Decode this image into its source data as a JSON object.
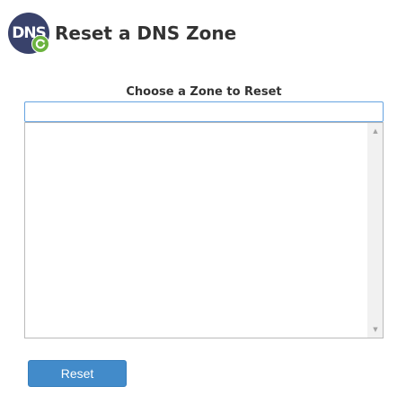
{
  "header": {
    "logo_text": "DNS",
    "logo_icon": "dns-logo-icon",
    "title": "Reset a DNS Zone"
  },
  "form": {
    "zone_label": "Choose a Zone to Reset",
    "search_value": "",
    "zone_options": [],
    "reset_label": "Reset"
  },
  "colors": {
    "accent": "#428bca",
    "logo_background": "#39426b",
    "logo_badge": "#6cb33f",
    "focus_border": "#66a3e0"
  },
  "icons": {
    "scroll_up": "scroll-up-arrow-icon",
    "scroll_down": "scroll-down-arrow-icon"
  }
}
